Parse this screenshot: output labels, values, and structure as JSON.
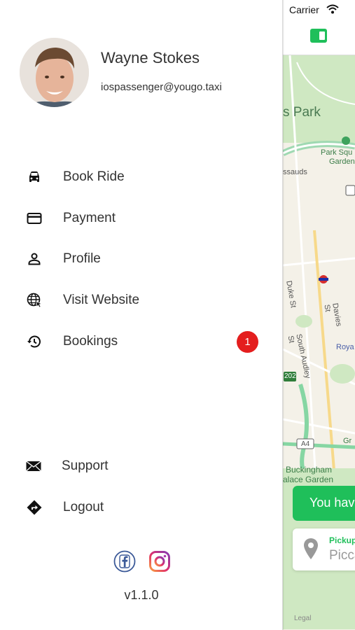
{
  "status_bar": {
    "carrier": "Carrier"
  },
  "user": {
    "name": "Wayne Stokes",
    "email": "iospassenger@yougo.taxi"
  },
  "menu": [
    {
      "label": "Book Ride",
      "icon": "car-icon"
    },
    {
      "label": "Payment",
      "icon": "credit-card-icon"
    },
    {
      "label": "Profile",
      "icon": "person-icon"
    },
    {
      "label": "Visit Website",
      "icon": "globe-icon"
    },
    {
      "label": "Bookings",
      "icon": "history-icon",
      "badge": "1"
    }
  ],
  "footer_menu": [
    {
      "label": "Support",
      "icon": "envelope-icon"
    },
    {
      "label": "Logout",
      "icon": "directions-icon"
    }
  ],
  "social": [
    {
      "name": "facebook-icon",
      "color": "#3b5998"
    },
    {
      "name": "instagram-icon",
      "color": "#c13584"
    }
  ],
  "version": "v1.1.0",
  "map": {
    "labels": {
      "park": "s Park",
      "park_square": "Park Squ",
      "garden": "Garden",
      "ssauds": "ssauds",
      "duke_st": "Duke St",
      "davies_st": "Davies St",
      "south_audley": "South Audley St",
      "roya": "Roya",
      "buckingham": "Buckingham",
      "palace_garden": "alace Garden",
      "a4": "A4",
      "road_202": "202",
      "gr": "Gr",
      "legal": "Legal"
    },
    "banner_text": "You hav",
    "pickup_label": "Pickup",
    "pickup_value": "Picca",
    "accent_color": "#1fbf5a"
  }
}
